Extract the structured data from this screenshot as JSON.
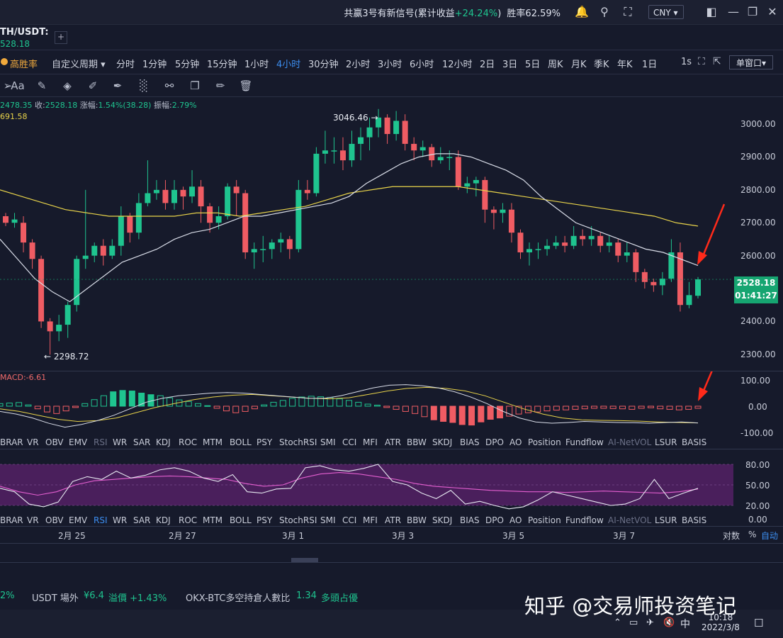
{
  "topbar": {
    "signal_prefix": "共赢3号有新信号(累计收益",
    "signal_pct": "+24.24%",
    "signal_close": ")",
    "winrate": "胜率62.59%",
    "currency": "CNY ▾",
    "icons": [
      "bell-icon",
      "search-icon",
      "shirt-icon",
      "window-layout-icon",
      "minimize-icon",
      "restore-icon",
      "close-icon"
    ]
  },
  "symbol": {
    "pair": "TH/USDT:",
    "price": "528.18",
    "add": "+"
  },
  "periods": {
    "high_win": "高胜率",
    "custom": "自定义周期 ▾",
    "items": [
      "分时",
      "1分钟",
      "5分钟",
      "15分钟",
      "1小时",
      "4小时",
      "30分钟",
      "2小时",
      "3小时",
      "6小时",
      "12小时",
      "2日",
      "3日",
      "5日",
      "周K",
      "月K",
      "季K",
      "年K",
      "1日"
    ],
    "active": "4小时",
    "interval": "1s",
    "single_window": "单窗口▾"
  },
  "info": {
    "open_partial": "2478.35",
    "close_label": "收:",
    "close": "2528.18",
    "change_label": "涨幅:",
    "change": "1.54%(38.28)",
    "amp_label": "振幅:",
    "amp": "2.79%",
    "ma_partial": "691.58"
  },
  "price_axis": [
    "3000.00",
    "2900.00",
    "2800.00",
    "2700.00",
    "2600.00",
    "2400.00",
    "2300.00"
  ],
  "last_price": "2528.18",
  "countdown": "01:41:27",
  "annotations": {
    "high": "3046.46 →",
    "low": "← 2298.72"
  },
  "macd": {
    "label": "MACD:-6.61",
    "axis": [
      "100.00",
      "0.00",
      "-100.00"
    ]
  },
  "rsi": {
    "axis": [
      "80.00",
      "50.00",
      "20.00",
      "0.00"
    ]
  },
  "indicators": [
    "BRAR",
    "VR",
    "OBV",
    "EMV",
    "RSI",
    "WR",
    "SAR",
    "KDJ",
    "ROC",
    "MTM",
    "BOLL",
    "PSY",
    "StochRSI",
    "SMI",
    "CCI",
    "MFI",
    "ATR",
    "BBW",
    "SKDJ",
    "BIAS",
    "DPO",
    "AO",
    "Position",
    "Fundflow",
    "AI-NetVOL",
    "LSUR",
    "BASIS"
  ],
  "time_axis": [
    "2月 25",
    "2月 27",
    "3月 1",
    "3月 3",
    "3月 5",
    "3月 7"
  ],
  "axis_mode": {
    "log": "对数",
    "pct": "%",
    "auto": "自动"
  },
  "ticker": {
    "pct_partial": "2%",
    "usdt_label": "USDT 場外",
    "usdt_price": "¥6.4",
    "premium": "溢價 +1.43%",
    "okx_label": "OKX-BTC多空持倉人數比",
    "okx_ratio": "1.34",
    "okx_state": "多頭占優"
  },
  "watermark": "知乎 @交易师投资笔记",
  "taskbar": {
    "time": "10:18",
    "date": "2022/3/8",
    "ime": "中"
  },
  "chart_data": {
    "type": "candlestick",
    "price_range": [
      2250,
      3080
    ],
    "candles": [
      [
        2720,
        2700,
        2730,
        2690
      ],
      [
        2700,
        2710,
        2730,
        2685
      ],
      [
        2700,
        2640,
        2720,
        2610
      ],
      [
        2640,
        2590,
        2650,
        2560
      ],
      [
        2590,
        2400,
        2600,
        2380
      ],
      [
        2400,
        2370,
        2410,
        2299
      ],
      [
        2370,
        2390,
        2420,
        2340
      ],
      [
        2390,
        2450,
        2460,
        2350
      ],
      [
        2450,
        2590,
        2600,
        2430
      ],
      [
        2590,
        2600,
        2800,
        2560
      ],
      [
        2600,
        2630,
        2640,
        2580
      ],
      [
        2630,
        2600,
        2650,
        2570
      ],
      [
        2600,
        2630,
        2650,
        2590
      ],
      [
        2630,
        2720,
        2750,
        2600
      ],
      [
        2720,
        2670,
        2730,
        2640
      ],
      [
        2670,
        2760,
        2790,
        2650
      ],
      [
        2760,
        2790,
        2890,
        2750
      ],
      [
        2790,
        2800,
        2830,
        2770
      ],
      [
        2800,
        2760,
        2830,
        2740
      ],
      [
        2760,
        2800,
        2830,
        2740
      ],
      [
        2800,
        2780,
        2810,
        2740
      ],
      [
        2780,
        2810,
        2860,
        2760
      ],
      [
        2810,
        2750,
        2830,
        2700
      ],
      [
        2750,
        2700,
        2760,
        2670
      ],
      [
        2700,
        2720,
        2750,
        2680
      ],
      [
        2720,
        2810,
        2820,
        2710
      ],
      [
        2810,
        2790,
        2830,
        2720
      ],
      [
        2790,
        2610,
        2800,
        2590
      ],
      [
        2610,
        2620,
        2640,
        2560
      ],
      [
        2620,
        2620,
        2660,
        2580
      ],
      [
        2620,
        2640,
        2650,
        2590
      ],
      [
        2640,
        2650,
        2670,
        2610
      ],
      [
        2650,
        2620,
        2660,
        2590
      ],
      [
        2620,
        2800,
        2830,
        2610
      ],
      [
        2800,
        2790,
        2830,
        2770
      ],
      [
        2790,
        2910,
        2930,
        2780
      ],
      [
        2910,
        2920,
        2980,
        2880
      ],
      [
        2920,
        2920,
        2960,
        2880
      ],
      [
        2920,
        2890,
        2960,
        2860
      ],
      [
        2890,
        2940,
        2980,
        2870
      ],
      [
        2940,
        2960,
        2990,
        2890
      ],
      [
        2960,
        2990,
        3020,
        2920
      ],
      [
        2990,
        3020,
        3046,
        2960
      ],
      [
        3020,
        2970,
        3030,
        2940
      ],
      [
        2970,
        3010,
        3040,
        2950
      ],
      [
        3010,
        2940,
        3030,
        2920
      ],
      [
        2940,
        2920,
        2960,
        2890
      ],
      [
        2920,
        2930,
        2950,
        2900
      ],
      [
        2930,
        2890,
        2940,
        2870
      ],
      [
        2890,
        2900,
        2930,
        2880
      ],
      [
        2900,
        2900,
        2920,
        2860
      ],
      [
        2900,
        2810,
        2920,
        2800
      ],
      [
        2810,
        2820,
        2840,
        2790
      ],
      [
        2820,
        2830,
        2840,
        2780
      ],
      [
        2830,
        2740,
        2840,
        2700
      ],
      [
        2740,
        2730,
        2750,
        2680
      ],
      [
        2730,
        2740,
        2760,
        2700
      ],
      [
        2740,
        2670,
        2760,
        2640
      ],
      [
        2670,
        2610,
        2680,
        2590
      ],
      [
        2610,
        2620,
        2640,
        2570
      ],
      [
        2620,
        2620,
        2640,
        2590
      ],
      [
        2620,
        2630,
        2650,
        2600
      ],
      [
        2630,
        2640,
        2660,
        2620
      ],
      [
        2640,
        2630,
        2660,
        2610
      ],
      [
        2630,
        2660,
        2690,
        2620
      ],
      [
        2660,
        2650,
        2680,
        2630
      ],
      [
        2650,
        2660,
        2690,
        2630
      ],
      [
        2660,
        2630,
        2670,
        2610
      ],
      [
        2630,
        2640,
        2660,
        2610
      ],
      [
        2640,
        2600,
        2650,
        2580
      ],
      [
        2600,
        2610,
        2640,
        2580
      ],
      [
        2610,
        2550,
        2620,
        2520
      ],
      [
        2550,
        2520,
        2560,
        2500
      ],
      [
        2520,
        2510,
        2530,
        2490
      ],
      [
        2510,
        2530,
        2550,
        2480
      ],
      [
        2530,
        2610,
        2650,
        2520
      ],
      [
        2610,
        2450,
        2640,
        2430
      ],
      [
        2450,
        2480,
        2520,
        2440
      ],
      [
        2478,
        2528,
        2535,
        2470
      ]
    ],
    "ma_fast": [
      2650,
      2590,
      2530,
      2490,
      2460,
      2500,
      2540,
      2580,
      2600,
      2620,
      2650,
      2670,
      2680,
      2700,
      2720,
      2720,
      2730,
      2740,
      2750,
      2760,
      2780,
      2820,
      2850,
      2880,
      2900,
      2910,
      2910,
      2900,
      2880,
      2860,
      2830,
      2780,
      2740,
      2700,
      2680,
      2660,
      2640,
      2620,
      2610,
      2590,
      2570
    ],
    "ma_slow": [
      2800,
      2780,
      2760,
      2740,
      2730,
      2720,
      2720,
      2720,
      2720,
      2730,
      2730,
      2720,
      2730,
      2740,
      2750,
      2770,
      2790,
      2800,
      2810,
      2810,
      2810,
      2810,
      2800,
      2790,
      2780,
      2770,
      2760,
      2750,
      2740,
      2730,
      2720,
      2700,
      2690
    ],
    "macd_hist": [
      10,
      12,
      14,
      5,
      -10,
      -22,
      -28,
      -18,
      -5,
      10,
      25,
      40,
      55,
      60,
      58,
      50,
      44,
      40,
      32,
      24,
      18,
      10,
      2,
      -8,
      -18,
      -25,
      -20,
      -10,
      5,
      15,
      22,
      30,
      35,
      38,
      36,
      33,
      28,
      22,
      15,
      8,
      4,
      -5,
      -12,
      -20,
      -28,
      -40,
      -52,
      -58,
      -62,
      -70,
      -72,
      -60,
      -50,
      -45,
      -38,
      -30,
      -25,
      -22,
      -18,
      -15,
      -14,
      -12,
      -10,
      -8,
      -8,
      -9,
      -10,
      -12,
      -8,
      -6,
      -10,
      -12,
      -14,
      -12,
      -8
    ],
    "macd_dif": [
      -20,
      -30,
      -45,
      -65,
      -80,
      -70,
      -55,
      -35,
      -10,
      15,
      30,
      40,
      45,
      50,
      52,
      50,
      45,
      40,
      35,
      30,
      30,
      40,
      55,
      70,
      80,
      82,
      78,
      70,
      55,
      35,
      10,
      -20,
      -45,
      -60,
      -65,
      -62,
      -58,
      -60,
      -62,
      -63,
      -65,
      -62,
      -60,
      -64
    ],
    "macd_dea": [
      -10,
      -20,
      -35,
      -50,
      -58,
      -55,
      -45,
      -25,
      -5,
      10,
      25,
      35,
      42,
      45,
      40,
      35,
      30,
      28,
      32,
      45,
      58,
      68,
      72,
      68,
      58,
      40,
      15,
      -10,
      -30,
      -45,
      -52,
      -54,
      -55,
      -57,
      -60,
      -62,
      -64
    ],
    "rsi": [
      45,
      40,
      22,
      18,
      25,
      55,
      62,
      58,
      70,
      60,
      64,
      72,
      75,
      70,
      60,
      55,
      65,
      40,
      38,
      44,
      45,
      75,
      78,
      72,
      70,
      74,
      80,
      55,
      50,
      38,
      30,
      42,
      22,
      26,
      20,
      15,
      18,
      28,
      40,
      35,
      30,
      25,
      20,
      22,
      30,
      58,
      30,
      38,
      45
    ],
    "rsi_ma": [
      48,
      40,
      35,
      40,
      50,
      56,
      58,
      60,
      62,
      63,
      62,
      60,
      58,
      52,
      48,
      50,
      60,
      66,
      68,
      66,
      62,
      58,
      52,
      48,
      46,
      44,
      42,
      41,
      40,
      40,
      39,
      40,
      41,
      40,
      39,
      38,
      40,
      44
    ]
  }
}
